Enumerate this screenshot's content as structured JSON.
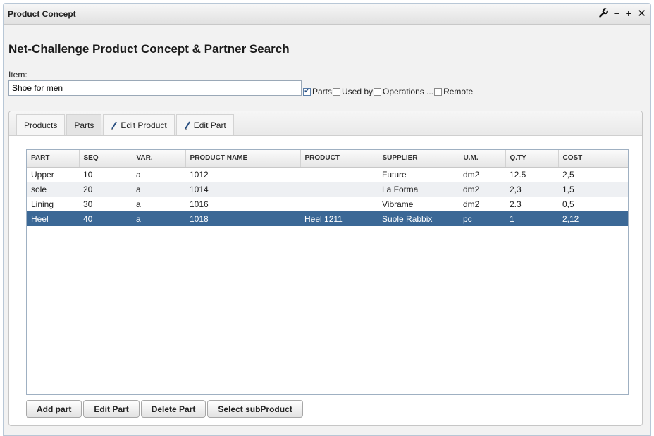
{
  "window": {
    "title": "Product Concept",
    "tools": {
      "wrench": "✎",
      "minimize": "−",
      "maximize": "+",
      "close": "✕"
    }
  },
  "heading": "Net-Challenge Product Concept & Partner Search",
  "item": {
    "label": "Item:",
    "value": "Shoe for men"
  },
  "options": [
    {
      "label": "Parts",
      "checked": true
    },
    {
      "label": "Used by",
      "checked": false
    },
    {
      "label": "Operations ...",
      "checked": false
    },
    {
      "label": "Remote",
      "checked": false
    }
  ],
  "tabs": {
    "products": "Products",
    "parts": "Parts",
    "edit_product": "Edit Product",
    "edit_part": "Edit Part"
  },
  "table": {
    "columns": [
      "PART",
      "SEQ",
      "VAR.",
      "PRODUCT NAME",
      "PRODUCT",
      "SUPPLIER",
      "U.M.",
      "Q.TY",
      "COST"
    ],
    "rows": [
      [
        "Upper",
        "10",
        "a",
        "1012",
        "",
        "Future",
        "dm2",
        "12.5",
        "2,5"
      ],
      [
        "sole",
        "20",
        "a",
        "1014",
        "",
        "La Forma",
        "dm2",
        "2,3",
        "1,5"
      ],
      [
        "Lining",
        "30",
        "a",
        "1016",
        "",
        "Vibrame",
        "dm2",
        "2.3",
        "0,5"
      ],
      [
        "Heel",
        "40",
        "a",
        "1018",
        "Heel 1211",
        "Suole Rabbix",
        "pc",
        "1",
        "2,12"
      ]
    ],
    "selected_row": 3
  },
  "buttons": {
    "add_part": "Add part",
    "edit_part": "Edit Part",
    "delete_part": "Delete Part",
    "select_subproduct": "Select subProduct"
  },
  "colors": {
    "selection": "#3b6896",
    "checkmark": "#2a4f80"
  }
}
